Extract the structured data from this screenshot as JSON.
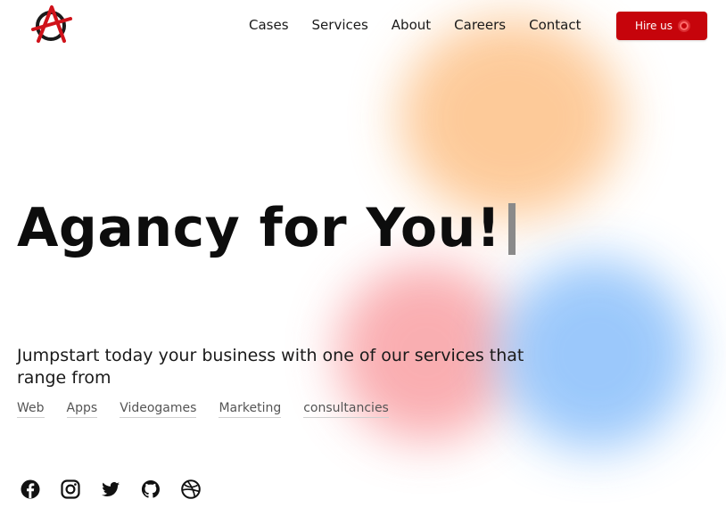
{
  "header": {
    "logo_icon": "anarchy-a-logo-icon",
    "nav": [
      {
        "label": "Cases"
      },
      {
        "label": "Services"
      },
      {
        "label": "About"
      },
      {
        "label": "Careers"
      },
      {
        "label": "Contact"
      }
    ],
    "hire_button": {
      "label": "Hire us",
      "accent": "#c6040b"
    }
  },
  "hero": {
    "title": "Agancy for You!",
    "subtitle": "Jumpstart today your business with one of our services that range from",
    "services": [
      "Web",
      "Apps",
      "Videogames",
      "Marketing",
      "consultancies"
    ]
  },
  "social_icons": [
    "facebook-icon",
    "instagram-icon",
    "twitter-icon",
    "github-icon",
    "dribbble-icon"
  ],
  "colors": {
    "blob_orange": "#fdc58f",
    "blob_red": "#f9a0a4",
    "blob_blue": "#91c3fb"
  }
}
